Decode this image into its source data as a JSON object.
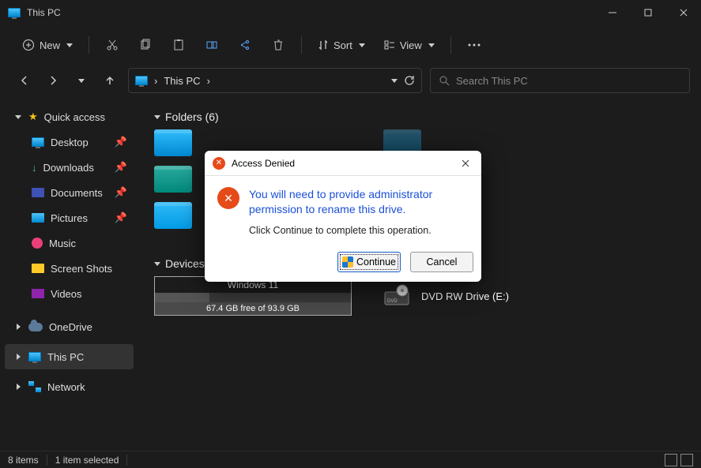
{
  "window": {
    "title": "This PC"
  },
  "toolbar": {
    "new_label": "New",
    "sort_label": "Sort",
    "view_label": "View"
  },
  "breadcrumb": {
    "location": "This PC"
  },
  "search": {
    "placeholder": "Search This PC"
  },
  "sidebar": {
    "quick_access": "Quick access",
    "items": [
      {
        "label": "Desktop",
        "icon": "desktop"
      },
      {
        "label": "Downloads",
        "icon": "download"
      },
      {
        "label": "Documents",
        "icon": "document"
      },
      {
        "label": "Pictures",
        "icon": "picture"
      },
      {
        "label": "Music",
        "icon": "music"
      },
      {
        "label": "Screen Shots",
        "icon": "folder"
      },
      {
        "label": "Videos",
        "icon": "video"
      }
    ],
    "onedrive": "OneDrive",
    "thispc": "This PC",
    "network": "Network"
  },
  "sections": {
    "folders_header": "Folders (6)",
    "drives_header": "Devices and drives (2)"
  },
  "drives": {
    "primary": {
      "name": "Windows 11",
      "free_text": "67.4 GB free of 93.9 GB",
      "fill_pct": 28
    },
    "optical": {
      "name": "DVD RW Drive (E:)"
    }
  },
  "dialog": {
    "title": "Access Denied",
    "message": "You will need to provide administrator permission to rename this drive.",
    "subtext": "Click Continue to complete this operation.",
    "continue_label": "Continue",
    "cancel_label": "Cancel"
  },
  "statusbar": {
    "items": "8 items",
    "selected": "1 item selected"
  }
}
